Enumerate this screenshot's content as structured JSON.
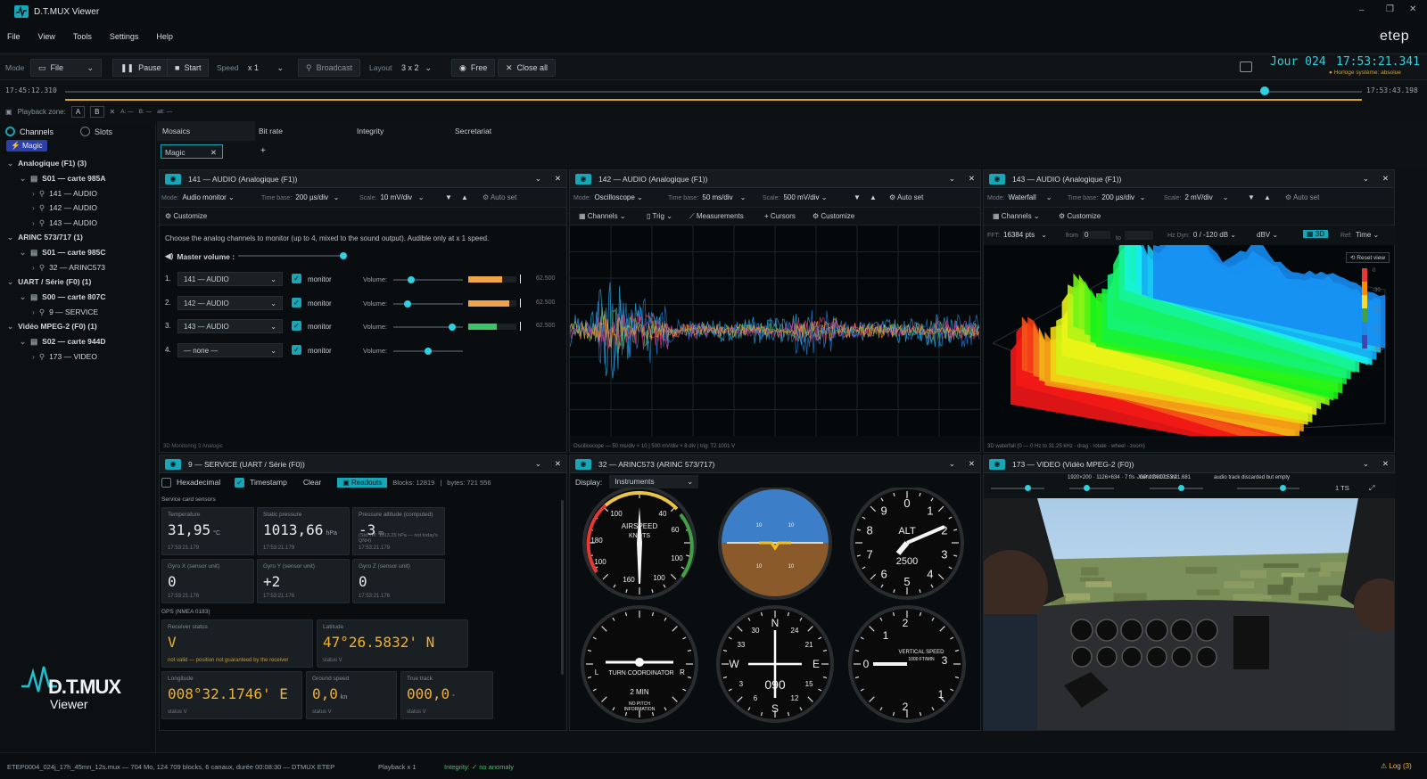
{
  "app": {
    "title": "D.T.MUX Viewer",
    "brand": "etep"
  },
  "menu": [
    "File",
    "View",
    "Tools",
    "Settings",
    "Help"
  ],
  "clock": {
    "day": "Jour 024",
    "time": "17:53:21.341",
    "note": "Horloge système: absolue"
  },
  "toolbar": {
    "mode_label": "Mode",
    "mode_value": "File",
    "pause": "Pause",
    "start": "Start",
    "speed_label": "Speed",
    "speed_value": "x 1",
    "broadcast": "Broadcast",
    "layout_label": "Layout",
    "layout_value": "3 x 2",
    "free": "Free",
    "close_all": "Close all"
  },
  "timeline": {
    "start": "17:45:12.310",
    "end": "17:53:43.198",
    "position": 0.925
  },
  "playback": {
    "label": "Playback zone:",
    "a": "A",
    "b": "B",
    "x": "✕",
    "f1": "A: —",
    "f2": "B: —",
    "f3": "alt: —"
  },
  "sidebar": {
    "tab_channels": "Channels",
    "tab_slots": "Slots",
    "magic": "Magic",
    "tree": [
      {
        "label": "Analogique (F1)  (3)",
        "level": 0,
        "bold": true
      },
      {
        "label": "S01 — carte 985A",
        "level": 1,
        "bold": true
      },
      {
        "label": "141 — AUDIO",
        "level": 2
      },
      {
        "label": "142 — AUDIO",
        "level": 2
      },
      {
        "label": "143 — AUDIO",
        "level": 2
      },
      {
        "label": "ARINC 573/717  (1)",
        "level": 0,
        "bold": true
      },
      {
        "label": "S01 — carte 985C",
        "level": 1,
        "bold": true
      },
      {
        "label": "32 — ARINC573",
        "level": 2
      },
      {
        "label": "UART / Série (F0)  (1)",
        "level": 0,
        "bold": true
      },
      {
        "label": "S00 — carte 807C",
        "level": 1,
        "bold": true
      },
      {
        "label": "9 — SERVICE",
        "level": 2
      },
      {
        "label": "Vidéo MPEG-2 (F0)  (1)",
        "level": 0,
        "bold": true
      },
      {
        "label": "S02 — carte 944D",
        "level": 1,
        "bold": true
      },
      {
        "label": "173 — VIDEO",
        "level": 2
      }
    ],
    "logo_main": "D.T.MUX",
    "logo_sub": "Viewer"
  },
  "tabs": {
    "items": [
      "Mosaics",
      "Bit rate",
      "Integrity",
      "Secretariat"
    ],
    "active_sub": "Magic",
    "add": "+"
  },
  "p1": {
    "title": "141 — AUDIO (Analogique (F1))",
    "mode_lbl": "Mode:",
    "mode": "Audio monitor",
    "tb_lbl": "Time base:",
    "tb": "200 µs/div",
    "sc_lbl": "Scale:",
    "sc": "10 mV/div",
    "auto": "Auto set",
    "customize": "Customize",
    "hint": "Choose the analog channels to monitor (up to 4, mixed to the sound output). Audible only at x 1 speed.",
    "master": "Master volume :",
    "monitor_lbl": "monitor",
    "volume_lbl": "Volume:",
    "rows": [
      {
        "n": "1.",
        "ch": "141 — AUDIO",
        "vol": 0.25,
        "lvl": 0.7,
        "color": "#f0a44a",
        "val": "62.500"
      },
      {
        "n": "2.",
        "ch": "142 — AUDIO",
        "vol": 0.2,
        "lvl": 0.85,
        "color": "#f0a44a",
        "val": "62.500"
      },
      {
        "n": "3.",
        "ch": "143 — AUDIO",
        "vol": 0.85,
        "lvl": 0.6,
        "color": "#3cc46a",
        "val": "62.500"
      },
      {
        "n": "4.",
        "ch": "— none —",
        "vol": 0.5,
        "lvl": 0,
        "color": "#3cc46a",
        "val": ""
      }
    ],
    "footer": "3D Monitoring 3 Analogic"
  },
  "p2": {
    "title": "142 — AUDIO (Analogique (F1))",
    "mode_lbl": "Mode:",
    "mode": "Oscilloscope",
    "tb_lbl": "Time base:",
    "tb": "50 ms/div",
    "sc_lbl": "Scale:",
    "sc": "500 mV/div",
    "auto": "Auto set",
    "channels": "Channels",
    "trig": "Trig",
    "measurements": "Measurements",
    "cursors": "Cursors",
    "customize": "Customize",
    "footer": "Oscilloscope — 50 ms/div × 10  |  500 mV/div × 8 div  |  trig: T2 1001 V"
  },
  "p3": {
    "title": "143 — AUDIO (Analogique (F1))",
    "mode_lbl": "Mode:",
    "mode": "Waterfall",
    "tb_lbl": "Time base:",
    "tb": "200 µs/div",
    "sc_lbl": "Scale:",
    "sc": "2 mV/div",
    "auto": "Auto set",
    "channels": "Channels",
    "customize": "Customize",
    "fft_lbl": "FFT:",
    "fft": "16384 pts",
    "from_lbl": "from",
    "from": "0",
    "to_lbl": "to",
    "hz_lbl": "Hz Dyn:",
    "dyn": "0 / -120 dB",
    "unit": "dBV",
    "btn3d": "3D",
    "ref_lbl": "Ref:",
    "ref": "Time",
    "reset": "Reset view",
    "footer": "3D waterfall (0 — 0 Hz to 31.25 kHz - drag - rotate - wheel - zoom)",
    "scale": [
      "0",
      "-30",
      "-60",
      "-90",
      "-120"
    ]
  },
  "p4": {
    "title": "9 — SERVICE (UART / Série (F0))",
    "hex": "Hexadecimal",
    "timestamp": "Timestamp",
    "clear": "Clear",
    "readouts": "Readouts",
    "blocks": "Blocks: 12819",
    "bytes": "bytes: 721 556",
    "sec1": "Service card sensors",
    "cards1": [
      {
        "t": "Temperature",
        "v": "31,95",
        "u": "°C",
        "s": "17:53:21.179"
      },
      {
        "t": "Static pressure",
        "v": "1013,66",
        "u": "hPa",
        "s": "17:53:21.179"
      },
      {
        "t": "Pressure altitude (computed)",
        "v": "-3",
        "u": "m",
        "s": "17:53:21.179",
        "s2": "(Std. ref. 1013.25 hPa — not today's QNH)"
      }
    ],
    "cards2": [
      {
        "t": "Gyro X (sensor unit)",
        "v": "0",
        "s": "17:53:21.176"
      },
      {
        "t": "Gyro Y (sensor unit)",
        "v": "+2",
        "s": "17:53:21.176"
      },
      {
        "t": "Gyro Z (sensor unit)",
        "v": "0",
        "s": "17:53:21.176"
      }
    ],
    "sec2": "GPS (NMEA 0183)",
    "gps1": [
      {
        "t": "Receiver status",
        "v": "V",
        "s": "not valid — position not guaranteed by the receiver"
      },
      {
        "t": "Latitude",
        "v": "47°26.5832' N",
        "s": "status V"
      }
    ],
    "gps2": [
      {
        "t": "Longitude",
        "v": "008°32.1746' E",
        "s": "status V"
      },
      {
        "t": "Ground speed",
        "v": "0,0",
        "u": "kn",
        "s": "status V"
      },
      {
        "t": "True track",
        "v": "000,0",
        "u": "°",
        "s": "status V"
      }
    ]
  },
  "p5": {
    "title": "32 — ARINC573 (ARINC 573/717)",
    "display_lbl": "Display:",
    "display": "Instruments",
    "asi": {
      "l1": "AIRSPEED",
      "l2": "KNOTS",
      "n": [
        "40",
        "60",
        "100",
        "140",
        "160",
        "180",
        "100"
      ]
    },
    "alt": {
      "l": "ALT",
      "v": "2500",
      "n": [
        "0",
        "1",
        "2",
        "3",
        "4",
        "5",
        "6",
        "7",
        "8",
        "9"
      ]
    },
    "tc": {
      "l": "TURN COORDINATOR",
      "m": "2 MIN",
      "np": "NO PITCH",
      "inf": "INFORMATION",
      "L": "L",
      "R": "R"
    },
    "hdg": {
      "v": "090",
      "N": "N",
      "E": "E",
      "S": "S",
      "W": "W",
      "n": [
        "33",
        "30",
        "24",
        "21",
        "15",
        "12",
        "6",
        "3"
      ]
    },
    "vsi": {
      "l1": "VERTICAL SPEED",
      "l2": "1000 FT/MIN",
      "n": [
        "0",
        "1",
        "2",
        "3",
        "2",
        "1"
      ]
    },
    "ai": {
      "n": [
        "10",
        "10",
        "10",
        "10"
      ]
    }
  },
  "p6": {
    "title": "173 — VIDEO (Vidéo MPEG-2 (F0))",
    "info1": "1920×200 · 1126×634 · 7 f/s · GPU D3D11 VA",
    "info2": "Jour 024 17:53:21.681",
    "info3": "audio track discarded but empty",
    "ts": "1 TS"
  },
  "status": {
    "file": "ETEP0004_024j_17h_45mn_12s.mux — 704 Mo, 124 709 blocks, 6 canaux, durée 00:08:30 — DTMUX ETEP",
    "playback": "Playback x 1",
    "integrity_lbl": "Integrity:",
    "integrity": "no anomaly",
    "log": "Log (3)"
  },
  "colors": {
    "accent": "#16a7b8",
    "clock": "#2fd0e0",
    "amber": "#f0b030"
  }
}
